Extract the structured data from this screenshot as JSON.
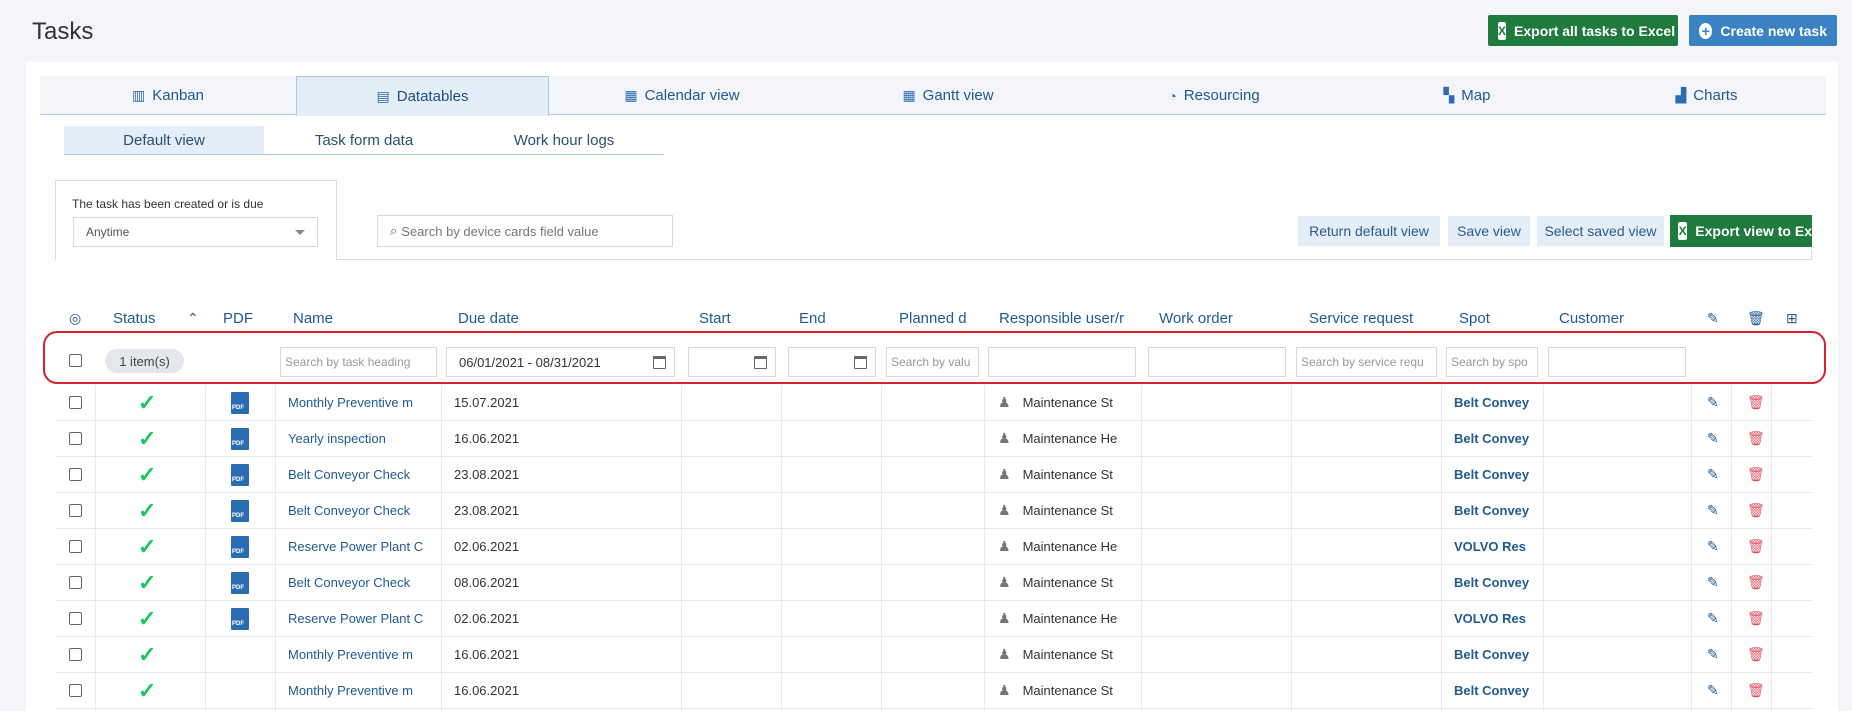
{
  "page": {
    "title": "Tasks",
    "export_all_label": "Export all tasks to Excel",
    "create_label": "Create new task"
  },
  "tabs": [
    {
      "label": "Kanban",
      "icon": "kanban-icon",
      "glyph": "▥"
    },
    {
      "label": "Datatables",
      "icon": "datatable-icon",
      "glyph": "▤"
    },
    {
      "label": "Calendar view",
      "icon": "calendar-icon",
      "glyph": "▦"
    },
    {
      "label": "Gantt view",
      "icon": "gantt-icon",
      "glyph": "▦"
    },
    {
      "label": "Resourcing",
      "icon": "resourcing-icon",
      "glyph": "◔"
    },
    {
      "label": "Map",
      "icon": "map-icon",
      "glyph": "▚"
    },
    {
      "label": "Charts",
      "icon": "charts-icon",
      "glyph": "▟"
    }
  ],
  "subtabs": [
    "Default view",
    "Task form data",
    "Work hour logs"
  ],
  "filters": {
    "created_due_label": "The task has been created or is due",
    "created_due_value": "Anytime",
    "device_search_placeholder": "Search by device cards field value"
  },
  "view_buttons": {
    "return_default": "Return default view",
    "save": "Save view",
    "select_saved": "Select saved view",
    "export_view": "Export view to Ex"
  },
  "columns": [
    "Status",
    "PDF",
    "Name",
    "Due date",
    "Start",
    "End",
    "Planned d",
    "Responsible user/r",
    "Work order",
    "Service request",
    "Spot",
    "Customer"
  ],
  "filter_row": {
    "status_pill": "1 item(s)",
    "name_placeholder": "Search by task heading",
    "due_range": "06/01/2021 - 08/31/2021",
    "planned_placeholder": "Search by valu",
    "service_placeholder": "Search by service requ",
    "spot_placeholder": "Search by spo"
  },
  "rows": [
    {
      "pdf": true,
      "name": "Monthly Preventive m",
      "due": "15.07.2021",
      "user": "Maintenance St",
      "spot": "Belt Convey"
    },
    {
      "pdf": true,
      "name": "Yearly inspection",
      "due": "16.06.2021",
      "user": "Maintenance He",
      "spot": "Belt Convey"
    },
    {
      "pdf": true,
      "name": "Belt Conveyor Check",
      "due": "23.08.2021",
      "user": "Maintenance St",
      "spot": "Belt Convey"
    },
    {
      "pdf": true,
      "name": "Belt Conveyor Check",
      "due": "23.08.2021",
      "user": "Maintenance St",
      "spot": "Belt Convey"
    },
    {
      "pdf": true,
      "name": "Reserve Power Plant C",
      "due": "02.06.2021",
      "user": "Maintenance He",
      "spot": "VOLVO Res"
    },
    {
      "pdf": true,
      "name": "Belt Conveyor Check",
      "due": "08.06.2021",
      "user": "Maintenance St",
      "spot": "Belt Convey"
    },
    {
      "pdf": true,
      "name": "Reserve Power Plant C",
      "due": "02.06.2021",
      "user": "Maintenance He",
      "spot": "VOLVO Res"
    },
    {
      "pdf": false,
      "name": "Monthly Preventive m",
      "due": "16.06.2021",
      "user": "Maintenance St",
      "spot": "Belt Convey"
    },
    {
      "pdf": false,
      "name": "Monthly Preventive m",
      "due": "16.06.2021",
      "user": "Maintenance St",
      "spot": "Belt Convey"
    }
  ],
  "colors": {
    "accent": "#1f5a93",
    "excel": "#1f7a3d",
    "highlight": "#d92030",
    "status_ok": "#22c55e"
  }
}
